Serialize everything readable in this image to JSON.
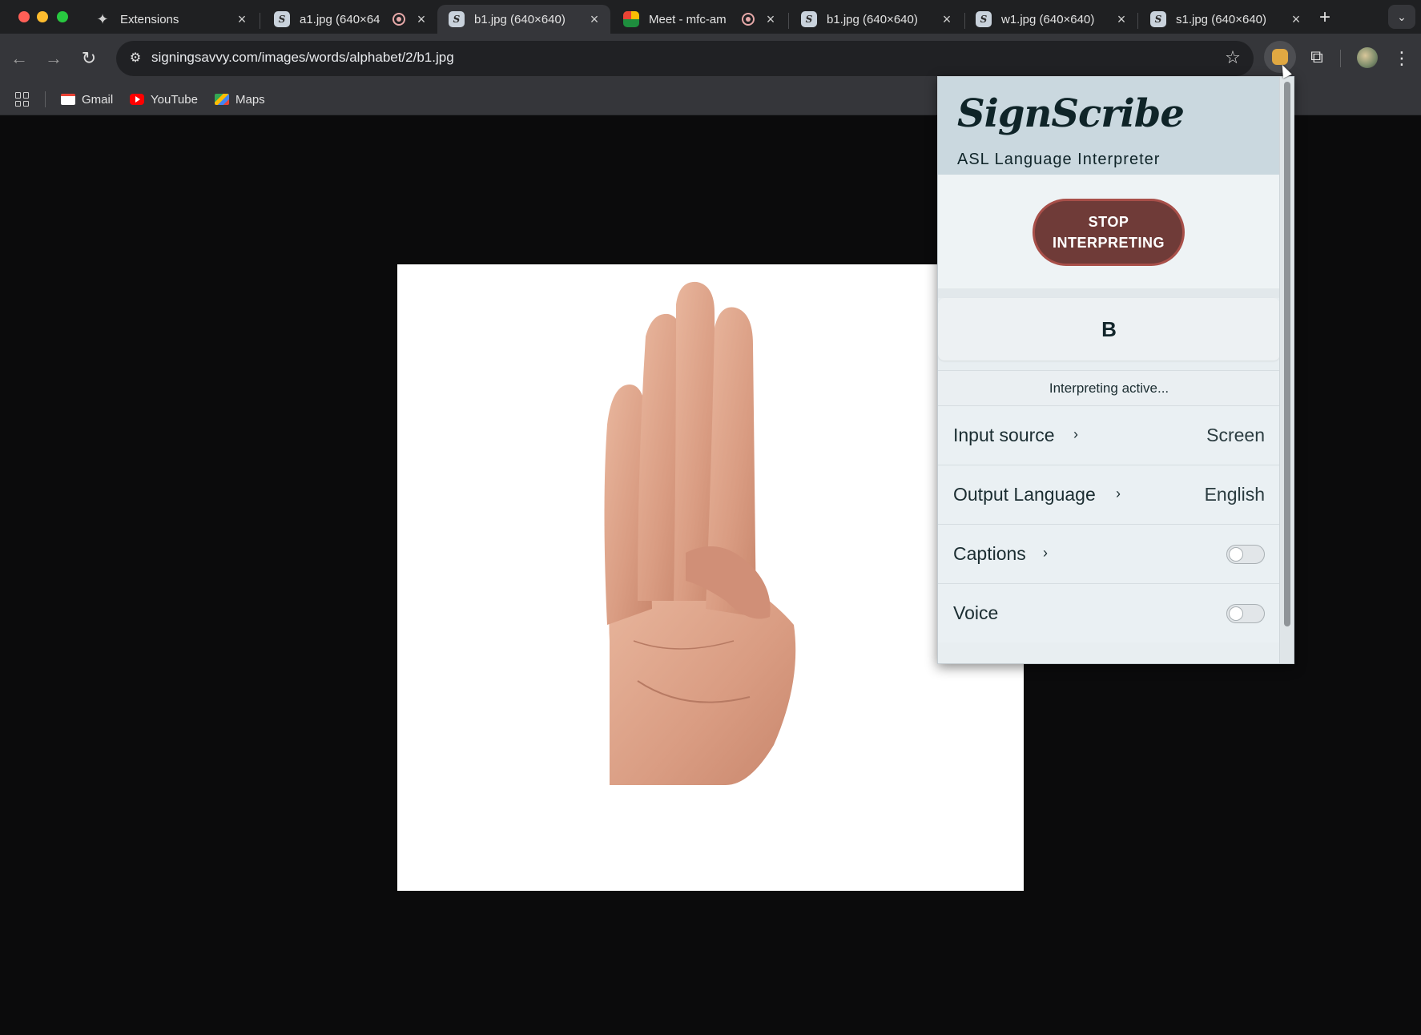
{
  "window": {
    "controls": [
      "close",
      "minimize",
      "zoom"
    ]
  },
  "tabs": [
    {
      "title": "Extensions",
      "icon": "puzzle-icon",
      "active": false,
      "recording": false
    },
    {
      "title": "a1.jpg (640×64",
      "icon": "signingsavvy-favicon",
      "active": false,
      "recording": true
    },
    {
      "title": "b1.jpg (640×640)",
      "icon": "signingsavvy-favicon",
      "active": true,
      "recording": false
    },
    {
      "title": "Meet - mfc-am",
      "icon": "meet-favicon",
      "active": false,
      "recording": true
    },
    {
      "title": "b1.jpg (640×640)",
      "icon": "signingsavvy-favicon",
      "active": false,
      "recording": false
    },
    {
      "title": "w1.jpg (640×640)",
      "icon": "signingsavvy-favicon",
      "active": false,
      "recording": false
    },
    {
      "title": "s1.jpg (640×640)",
      "icon": "signingsavvy-favicon",
      "active": false,
      "recording": false
    }
  ],
  "toolbar": {
    "url": "signingsavvy.com/images/words/alphabet/2/b1.jpg",
    "back_icon": "←",
    "forward_icon": "→",
    "reload_icon": "↻",
    "star_icon": "☆",
    "kebab_icon": "⋮"
  },
  "bookmarks": [
    {
      "label": "Gmail",
      "icon": "gmail-icon"
    },
    {
      "label": "YouTube",
      "icon": "youtube-icon"
    },
    {
      "label": "Maps",
      "icon": "maps-icon"
    }
  ],
  "page": {
    "image_subject": "ASL letter B hand sign"
  },
  "popup": {
    "brand": "SignScribe",
    "subtitle": "ASL Language Interpreter",
    "stop_button_line1": "STOP",
    "stop_button_line2": "INTERPRETING",
    "detected_letter": "B",
    "status": "Interpreting active...",
    "settings": {
      "input_source": {
        "label": "Input source",
        "value": "Screen"
      },
      "output_language": {
        "label": "Output Language",
        "value": "English"
      },
      "captions": {
        "label": "Captions",
        "enabled": false
      },
      "voice": {
        "label": "Voice",
        "enabled": false
      }
    },
    "colors": {
      "header_bg": "#cad8df",
      "stop_button_bg": "#6f3b38",
      "stop_button_border": "#a84f49"
    }
  }
}
